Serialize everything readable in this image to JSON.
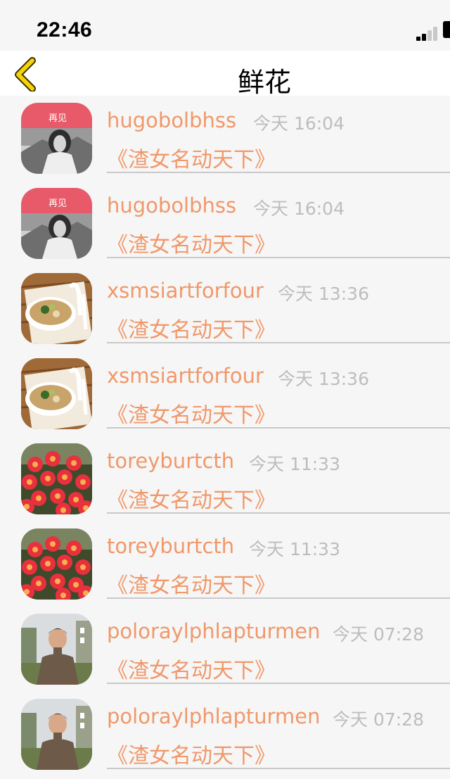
{
  "status_bar": {
    "time": "22:46"
  },
  "nav": {
    "title": "鲜花"
  },
  "messages": [
    {
      "username": "hugobolbhss",
      "time": "今天 16:04",
      "subtitle": "《渣女名动天下》",
      "avatar": "woman-portrait-photo",
      "avatar_text": "再见"
    },
    {
      "username": "hugobolbhss",
      "time": "今天 16:04",
      "subtitle": "《渣女名动天下》",
      "avatar": "woman-portrait-photo",
      "avatar_text": "再见"
    },
    {
      "username": "xsmsiartforfour",
      "time": "今天 13:36",
      "subtitle": "《渣女名动天下》",
      "avatar": "noodle-bowl-photo"
    },
    {
      "username": "xsmsiartforfour",
      "time": "今天 13:36",
      "subtitle": "《渣女名动天下》",
      "avatar": "noodle-bowl-photo"
    },
    {
      "username": "toreyburtcth",
      "time": "今天 11:33",
      "subtitle": "《渣女名动天下》",
      "avatar": "red-flowers-photo"
    },
    {
      "username": "toreyburtcth",
      "time": "今天 11:33",
      "subtitle": "《渣女名动天下》",
      "avatar": "red-flowers-photo"
    },
    {
      "username": "poloraylphlapturmen",
      "time": "今天 07:28",
      "subtitle": "《渣女名动天下》",
      "avatar": "man-portrait-photo"
    },
    {
      "username": "poloraylphlapturmen",
      "time": "今天 07:28",
      "subtitle": "《渣女名动天下》",
      "avatar": "man-portrait-photo"
    }
  ],
  "colors": {
    "accent": "#f0986a",
    "time": "#bdbdbd",
    "back_icon": "#f5d20a"
  }
}
